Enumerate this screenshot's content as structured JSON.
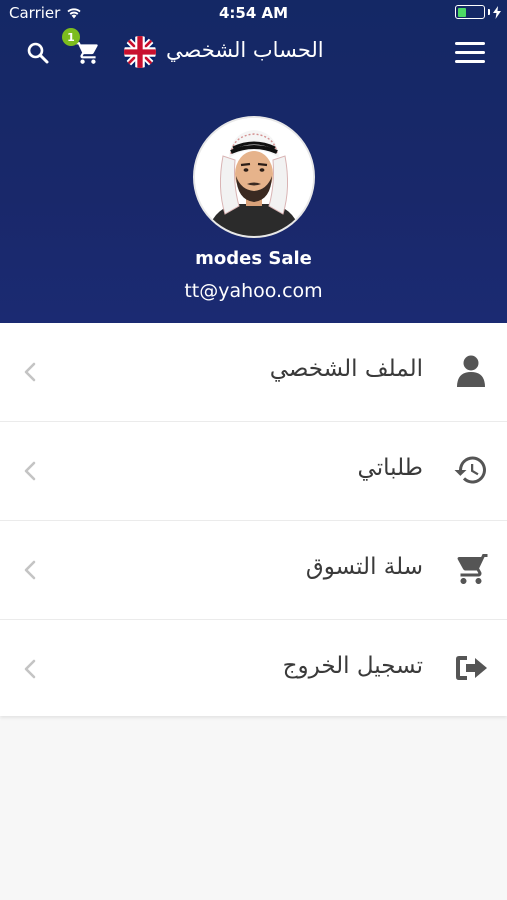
{
  "status_bar": {
    "carrier": "Carrier",
    "time": "4:54 AM"
  },
  "nav": {
    "title": "الحساب الشخصي",
    "cart_count": "1",
    "language_flag": "uk-flag-icon"
  },
  "profile": {
    "name": "modes Sale",
    "email": "tt@yahoo.com"
  },
  "menu": [
    {
      "label": "الملف الشخصي",
      "icon": "user-icon"
    },
    {
      "label": "طلباتي",
      "icon": "history-icon"
    },
    {
      "label": "سلة التسوق",
      "icon": "cart-icon"
    },
    {
      "label": "تسجيل الخروج",
      "icon": "logout-icon"
    }
  ],
  "colors": {
    "header_bg": "#142865",
    "badge": "#7cbd1e",
    "battery": "#4cd964",
    "icon_gray": "#555555"
  }
}
